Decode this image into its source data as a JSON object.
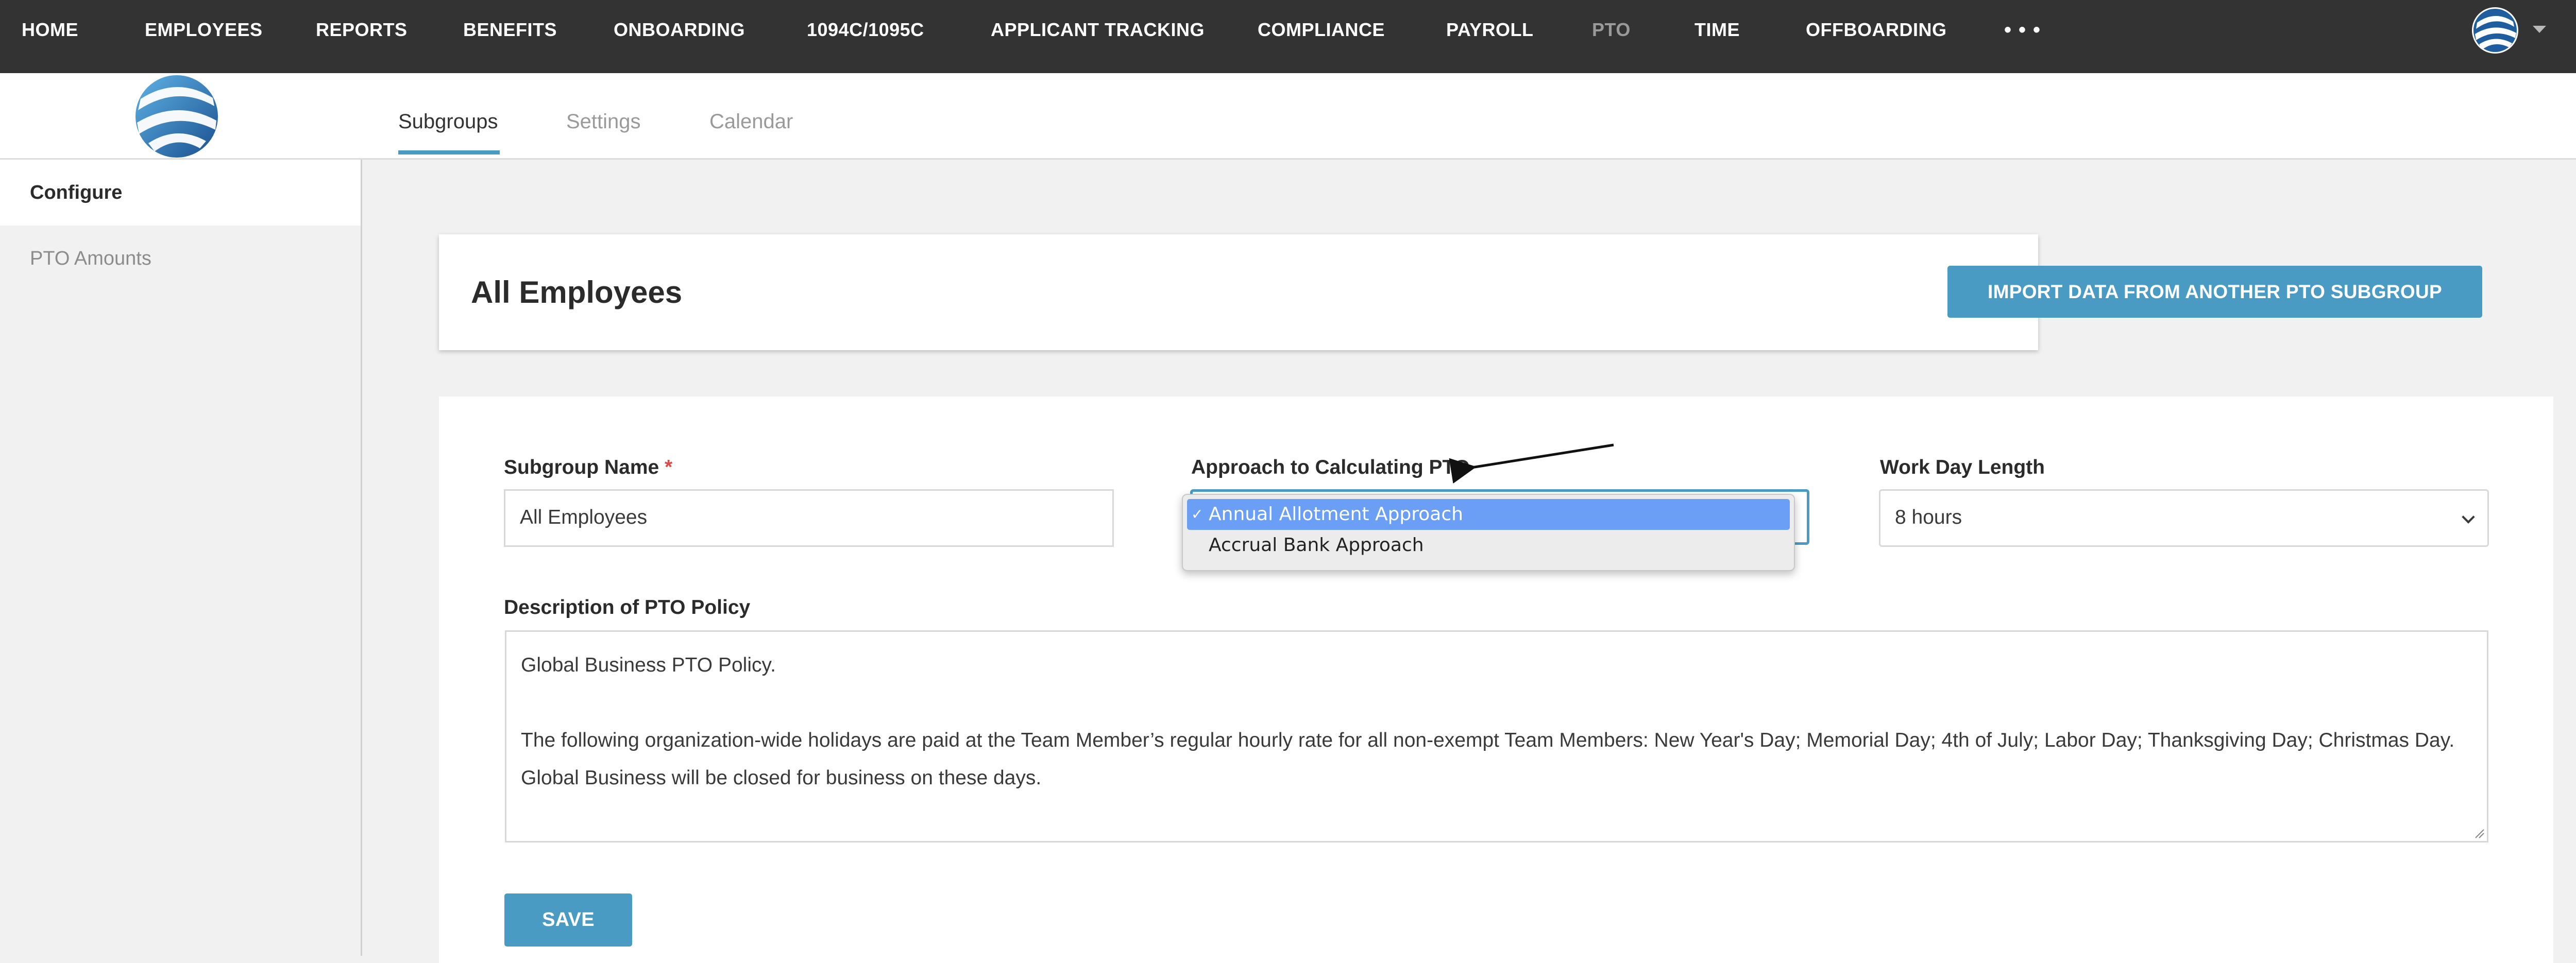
{
  "nav": {
    "items": [
      {
        "label": "HOME"
      },
      {
        "label": "EMPLOYEES"
      },
      {
        "label": "REPORTS"
      },
      {
        "label": "BENEFITS"
      },
      {
        "label": "ONBOARDING"
      },
      {
        "label": "1094C/1095C"
      },
      {
        "label": "APPLICANT TRACKING"
      },
      {
        "label": "COMPLIANCE"
      },
      {
        "label": "PAYROLL"
      },
      {
        "label": "PTO",
        "active": true
      },
      {
        "label": "TIME"
      },
      {
        "label": "OFFBOARDING"
      }
    ],
    "more_label": "•••"
  },
  "tabs": [
    {
      "label": "Subgroups",
      "active": true
    },
    {
      "label": "Settings"
    },
    {
      "label": "Calendar"
    }
  ],
  "sidebar": {
    "items": [
      {
        "label": "Configure",
        "active": true
      },
      {
        "label": "PTO Amounts"
      }
    ]
  },
  "header": {
    "title": "All Employees",
    "import_button": "IMPORT DATA FROM ANOTHER PTO SUBGROUP"
  },
  "form": {
    "subgroup_name_label": "Subgroup Name",
    "required_marker": "*",
    "subgroup_name_value": "All Employees",
    "approach_label": "Approach to Calculating PTO",
    "approach_options": [
      {
        "label": "Annual Allotment Approach",
        "selected": true
      },
      {
        "label": "Accrual Bank Approach",
        "selected": false
      }
    ],
    "check_mark": "✓",
    "work_day_label": "Work Day Length",
    "work_day_value": "8 hours",
    "description_label": "Description of PTO Policy",
    "description_lines": [
      "Global Business PTO Policy.",
      "",
      "The following organization-wide holidays are paid at the Team Member’s regular hourly rate for all non-exempt Team Members: New Year's Day; Memorial Day; 4th of July; Labor Day; Thanksgiving Day; Christmas Day.",
      "Global Business will be closed for business on these days."
    ],
    "save_button": "SAVE"
  },
  "colors": {
    "accent": "#4a9bc3",
    "nav_bg": "#333333",
    "selected_option": "#6b9ef5",
    "required": "#d94a4a"
  }
}
